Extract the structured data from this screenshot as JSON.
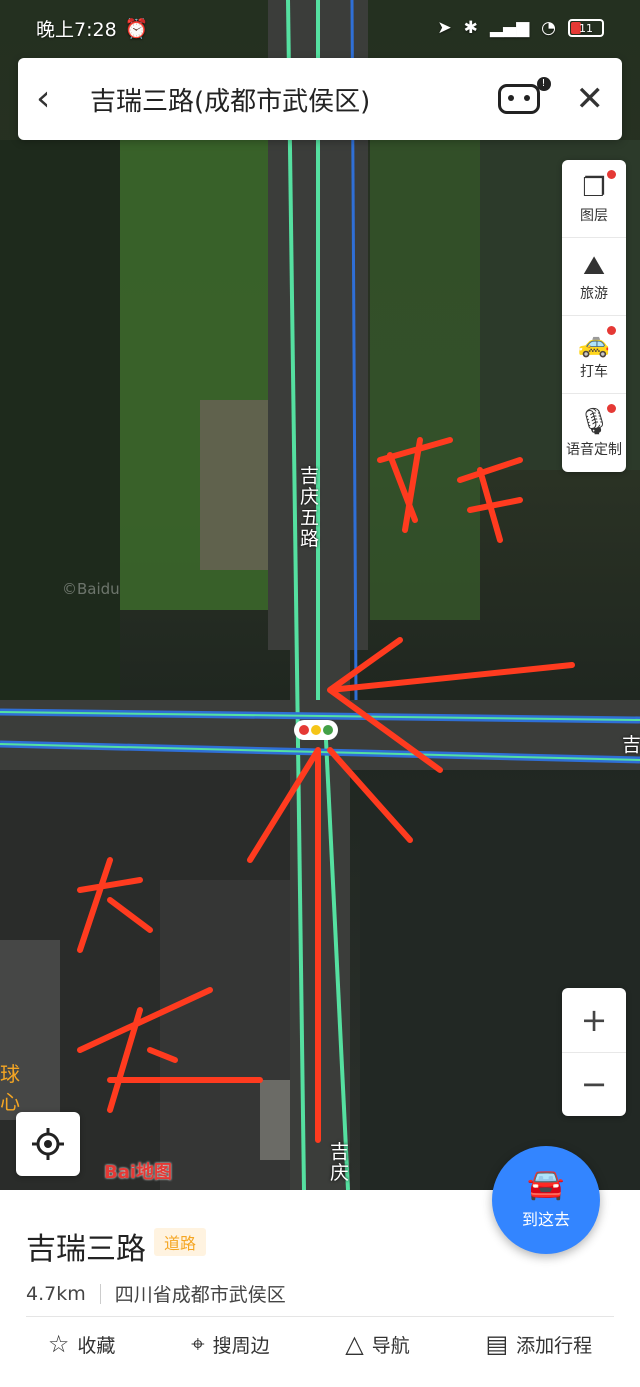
{
  "status": {
    "time": "晚上7:28",
    "battery": "11"
  },
  "header": {
    "title": "吉瑞三路(成都市武侯区)"
  },
  "tools": [
    {
      "label": "图层",
      "icon": "layers-icon"
    },
    {
      "label": "旅游",
      "icon": "travel-icon"
    },
    {
      "label": "打车",
      "icon": "taxi-icon"
    },
    {
      "label": "语音定制",
      "icon": "microphone-icon"
    }
  ],
  "map": {
    "road_label_north": "吉庆五路",
    "road_label_south": "吉庆",
    "road_label_east": "吉",
    "watermark": "©Baidu",
    "logo": "Bai地图",
    "edge_text": "球心"
  },
  "go": {
    "label": "到这去"
  },
  "place": {
    "name": "吉瑞三路",
    "tag": "道路",
    "distance": "4.7km",
    "address": "四川省成都市武侯区"
  },
  "actions": [
    {
      "label": "收藏",
      "icon": "star-icon"
    },
    {
      "label": "搜周边",
      "icon": "location-pin-icon"
    },
    {
      "label": "导航",
      "icon": "navigation-icon"
    },
    {
      "label": "添加行程",
      "icon": "calendar-icon"
    }
  ],
  "annotations": {
    "text_top": "FF",
    "text_bottom": "大红"
  }
}
